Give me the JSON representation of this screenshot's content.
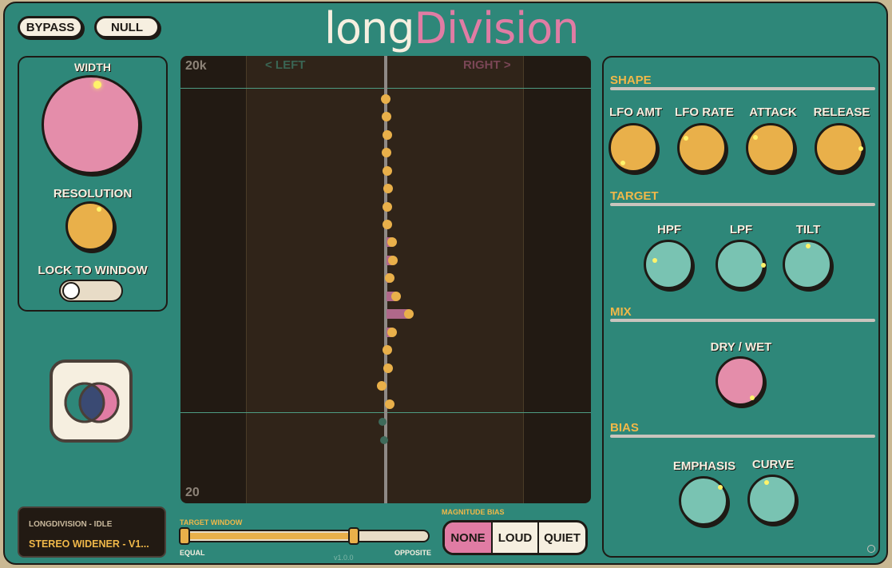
{
  "header": {
    "bypass_label": "BYPASS",
    "null_label": "NULL",
    "title_part1": "long",
    "title_part2": "Division"
  },
  "left_panel": {
    "width_label": "WIDTH",
    "resolution_label": "RESOLUTION",
    "lock_label": "LOCK TO WINDOW"
  },
  "visualizer": {
    "top_freq": "20k",
    "bottom_freq": "20",
    "left_label": "< LEFT",
    "right_label": "RIGHT >"
  },
  "status": {
    "line1": "LONGDIVISION - IDLE",
    "line2": "STEREO WIDENER - V1..."
  },
  "target_window": {
    "label": "TARGET WINDOW",
    "min_label": "EQUAL",
    "max_label": "OPPOSITE",
    "version": "v1.0.0"
  },
  "magnitude_bias": {
    "label": "MAGNITUDE BIAS",
    "options": [
      "NONE",
      "LOUD",
      "QUIET"
    ],
    "selected": "NONE"
  },
  "right_panel": {
    "shape": {
      "title": "SHAPE",
      "knobs": [
        "LFO AMT",
        "LFO RATE",
        "ATTACK",
        "RELEASE"
      ]
    },
    "target": {
      "title": "TARGET",
      "knobs": [
        "HPF",
        "LPF",
        "TILT"
      ]
    },
    "mix": {
      "title": "MIX",
      "knobs": [
        "DRY / WET"
      ]
    },
    "bias": {
      "title": "BIAS",
      "knobs": [
        "EMPHASIS",
        "CURVE"
      ]
    }
  },
  "colors": {
    "background": "#2e8779",
    "accent_pink": "#e07ca4",
    "accent_yellow": "#e9b04a",
    "knob_teal": "#79c3b2",
    "cream": "#f6efe0",
    "dark": "#1e1a15"
  }
}
